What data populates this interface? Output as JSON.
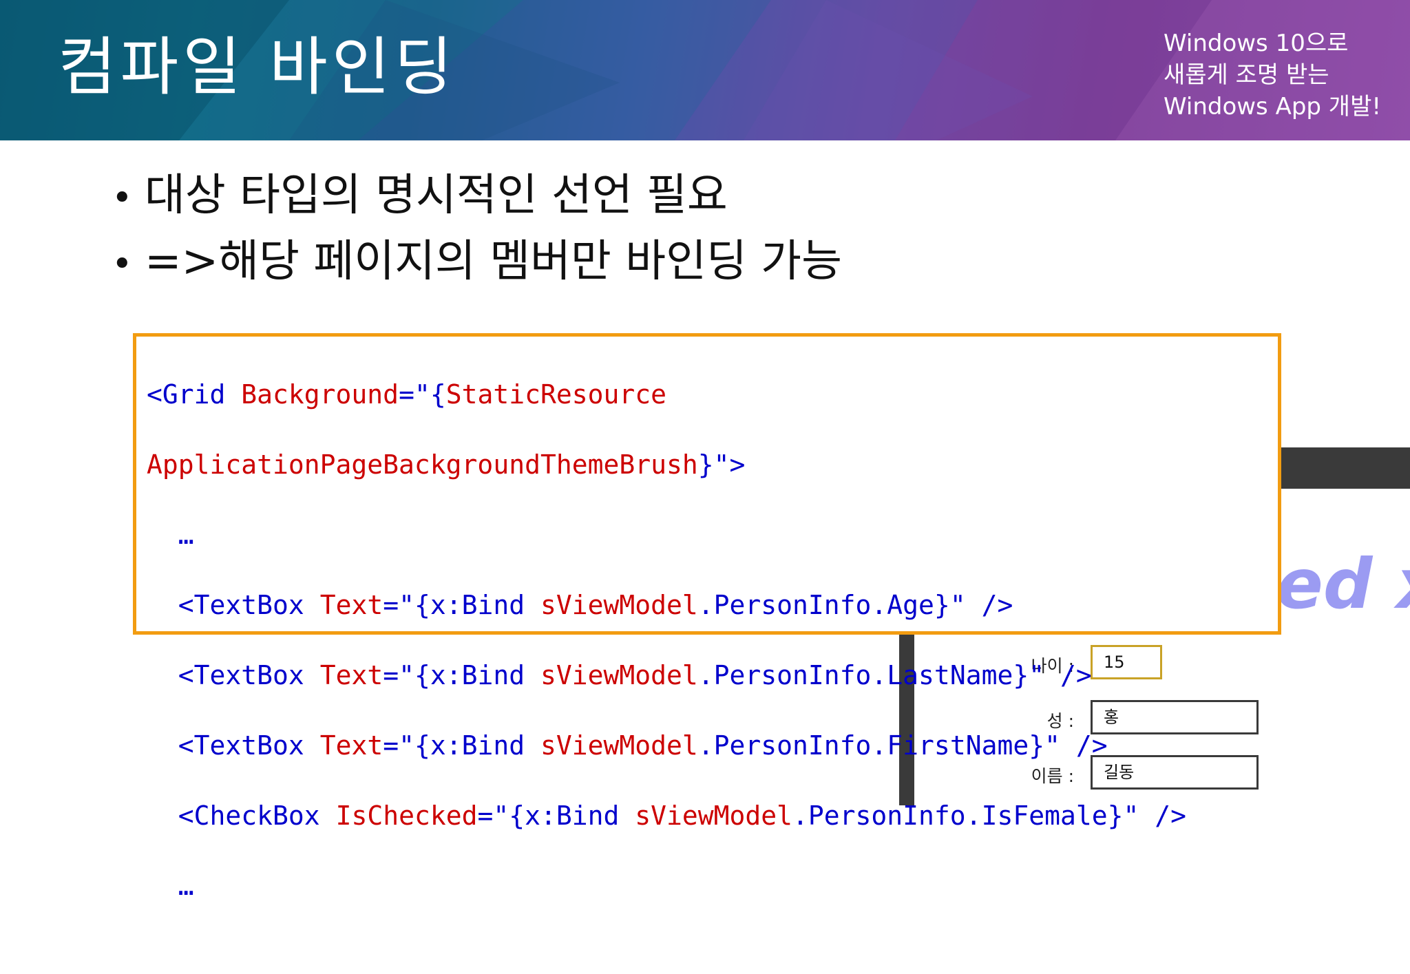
{
  "header": {
    "title": "컴파일 바인딩",
    "tagline": [
      "Windows 10으로",
      "새롭게 조명 받는",
      "Windows App 개발!"
    ]
  },
  "bullets": [
    "대상 타입의 명시적인 선언 필요",
    "=>해당 페이지의 멤버만 바인딩 가능"
  ],
  "code": {
    "line1": {
      "tag": "<Grid",
      "attr": "Background",
      "eq": "=\"{",
      "ext": "StaticResource"
    },
    "line2": {
      "key": "ApplicationPageBackgroundThemeBrush",
      "close": "}\">"
    },
    "ellipsis": "…",
    "textboxes": [
      {
        "tag": "<TextBox",
        "attr": "Text",
        "open": "=\"{x:Bind ",
        "obj": "sViewModel",
        "path": ".PersonInfo.Age}\" />"
      },
      {
        "tag": "<TextBox",
        "attr": "Text",
        "open": "=\"{x:Bind ",
        "obj": "sViewModel",
        "path": ".PersonInfo.LastName}\" />"
      },
      {
        "tag": "<TextBox",
        "attr": "Text",
        "open": "=\"{x:Bind ",
        "obj": "sViewModel",
        "path": ".PersonInfo.FirstName}\" />"
      }
    ],
    "checkbox": {
      "tag": "<CheckBox",
      "attr": "IsChecked",
      "open": "=\"{x:Bind ",
      "obj": "sViewModel",
      "path": ".PersonInfo.IsFemale}\" />"
    },
    "ellipsis_end": "…"
  },
  "app_window": {
    "watermark": "ed x",
    "fields": [
      {
        "label": "나이 :",
        "value": "15"
      },
      {
        "label": "성 :",
        "value": "홍"
      },
      {
        "label": "이름 :",
        "value": "길동"
      }
    ]
  },
  "colors": {
    "accent_border": "#f29c11",
    "code_blue": "#0000cc",
    "code_red": "#cc0000",
    "focus_border": "#c9a227"
  }
}
